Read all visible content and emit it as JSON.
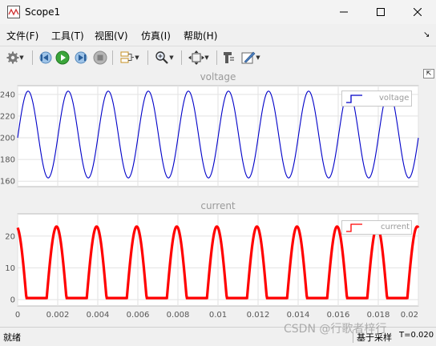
{
  "window": {
    "title": "Scope1",
    "minimize_icon": "minimize-icon",
    "maximize_icon": "maximize-icon",
    "close_icon": "close-icon"
  },
  "menu": {
    "items": [
      "文件(F)",
      "工具(T)",
      "视图(V)",
      "仿真(I)",
      "帮助(H)"
    ],
    "overflow_glyph": "↘"
  },
  "toolbar": {
    "icons": [
      "gear-icon",
      "step-back-icon",
      "run-icon",
      "step-forward-icon",
      "stop-icon",
      "signal-select-icon",
      "zoom-icon",
      "fit-icon",
      "cursor-measure-icon",
      "style-icon"
    ]
  },
  "plots": {
    "top": {
      "title": "voltage",
      "legend": "voltage",
      "yticks": [
        "240",
        "220",
        "200",
        "180",
        "160"
      ],
      "color": "#0000c8"
    },
    "bottom": {
      "title": "current",
      "legend": "current",
      "yticks": [
        "20",
        "10",
        "0"
      ],
      "xticks": [
        "0",
        "0.002",
        "0.004",
        "0.006",
        "0.008",
        "0.01",
        "0.012",
        "0.014",
        "0.016",
        "0.018",
        "0.02"
      ],
      "color": "#ff0000"
    }
  },
  "chart_data": [
    {
      "type": "line",
      "title": "voltage",
      "series": [
        {
          "name": "voltage",
          "function": "sine",
          "offset": 203,
          "amplitude": 40,
          "frequency_hz": 500,
          "start_value": 200
        }
      ],
      "xlim": [
        0,
        0.02
      ],
      "ylim": [
        155,
        248
      ],
      "yticks": [
        160,
        180,
        200,
        220,
        240
      ],
      "grid": true,
      "legend": "top-right"
    },
    {
      "type": "line",
      "title": "current",
      "series": [
        {
          "name": "current",
          "function": "clipped-sine",
          "peak": 23,
          "floor": 0.5,
          "frequency_hz": 500,
          "start_value": 21
        }
      ],
      "xlim": [
        0,
        0.02
      ],
      "ylim": [
        -2,
        27
      ],
      "yticks": [
        0,
        10,
        20
      ],
      "xticks": [
        0,
        0.002,
        0.004,
        0.006,
        0.008,
        0.01,
        0.012,
        0.014,
        0.016,
        0.018,
        0.02
      ],
      "grid": true,
      "legend": "top-right"
    }
  ],
  "status": {
    "left": "就绪",
    "sample_mode": "基于采样",
    "time": "T=0.020"
  },
  "watermark": "CSDN @行歌者梓行"
}
